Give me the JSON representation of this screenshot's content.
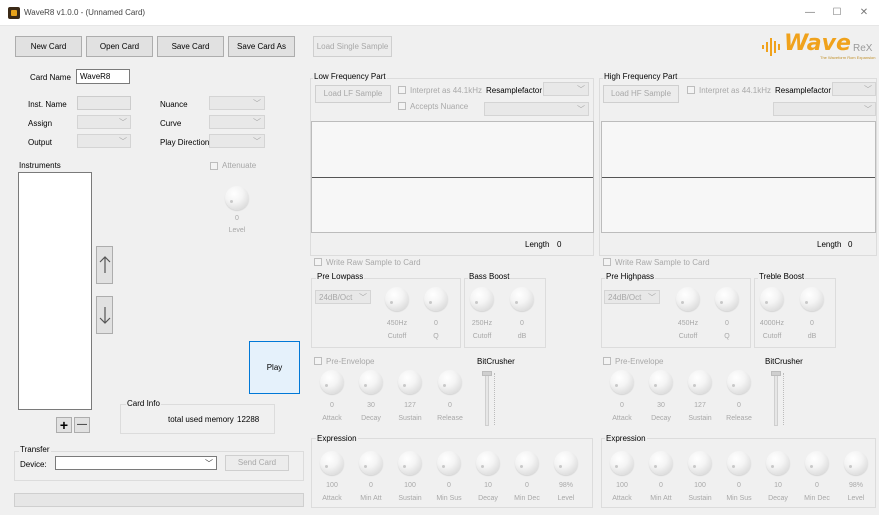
{
  "window": {
    "title": "WaveR8 v1.0.0 - (Unnamed Card)",
    "minimize": "—",
    "maximize": "☐",
    "close": "✕"
  },
  "toolbar": {
    "new_card": "New Card",
    "open_card": "Open Card",
    "save_card": "Save Card",
    "save_card_as": "Save Card As",
    "load_single_sample": "Load Single Sample"
  },
  "logo": {
    "text": "Wave",
    "suffix": "ReX",
    "tagline": "The Waveform Rom Expansion",
    "accent_color": "#f0a21c"
  },
  "card": {
    "name_label": "Card Name",
    "name_value": "WaveR8",
    "inst_name_label": "Inst. Name",
    "assign_label": "Assign",
    "output_label": "Output",
    "nuance_label": "Nuance",
    "curve_label": "Curve",
    "play_direction_label": "Play Direction"
  },
  "instruments": {
    "label": "Instruments",
    "attenuate_label": "Attenuate",
    "level_value": "0",
    "level_label": "Level",
    "up_icon": "arrow-up-icon",
    "down_icon": "arrow-down-icon",
    "add": "+",
    "remove": "—",
    "play": "Play"
  },
  "card_info": {
    "title": "Card Info",
    "memory_label": "total used memory",
    "memory_value": "12288"
  },
  "transfer": {
    "title": "Transfer",
    "device_label": "Device:",
    "send_card": "Send Card"
  },
  "low": {
    "title": "Low Frequency Part",
    "load_button": "Load LF Sample",
    "interpret_label": "Interpret as 44.1kHz",
    "accepts_nuance_label": "Accepts Nuance",
    "resample_label": "Resamplefactor",
    "length_label": "Length",
    "length_value": "0",
    "write_raw_label": "Write Raw Sample to Card",
    "filter_title": "Pre Lowpass",
    "filter_slope": "24dB/Oct",
    "filter_knobs": [
      {
        "value": "450Hz",
        "label": "Cutoff"
      },
      {
        "value": "0",
        "label": "Q"
      }
    ],
    "boost_title": "Bass Boost",
    "boost_knobs": [
      {
        "value": "250Hz",
        "label": "Cutoff"
      },
      {
        "value": "0",
        "label": "dB"
      }
    ],
    "envelope_label": "Pre-Envelope",
    "envelope_knobs": [
      {
        "value": "0",
        "label": "Attack"
      },
      {
        "value": "30",
        "label": "Decay"
      },
      {
        "value": "127",
        "label": "Sustain"
      },
      {
        "value": "0",
        "label": "Release"
      }
    ],
    "bitcrusher_label": "BitCrusher"
  },
  "high": {
    "title": "High Frequency Part",
    "load_button": "Load HF Sample",
    "interpret_label": "Interpret as 44.1kHz",
    "resample_label": "Resamplefactor",
    "length_label": "Length",
    "length_value": "0",
    "write_raw_label": "Write Raw Sample to Card",
    "filter_title": "Pre Highpass",
    "filter_slope": "24dB/Oct",
    "filter_knobs": [
      {
        "value": "450Hz",
        "label": "Cutoff"
      },
      {
        "value": "0",
        "label": "Q"
      }
    ],
    "boost_title": "Treble Boost",
    "boost_knobs": [
      {
        "value": "4000Hz",
        "label": "Cutoff"
      },
      {
        "value": "0",
        "label": "dB"
      }
    ],
    "envelope_label": "Pre-Envelope",
    "envelope_knobs": [
      {
        "value": "0",
        "label": "Attack"
      },
      {
        "value": "30",
        "label": "Decay"
      },
      {
        "value": "127",
        "label": "Sustain"
      },
      {
        "value": "0",
        "label": "Release"
      }
    ],
    "bitcrusher_label": "BitCrusher"
  },
  "expression_low": {
    "title": "Expression",
    "knobs": [
      {
        "value": "100",
        "label": "Attack"
      },
      {
        "value": "0",
        "label": "Min Att"
      },
      {
        "value": "100",
        "label": "Sustain"
      },
      {
        "value": "0",
        "label": "Min Sus"
      },
      {
        "value": "10",
        "label": "Decay"
      },
      {
        "value": "0",
        "label": "Min Dec"
      },
      {
        "value": "98%",
        "label": "Level"
      }
    ]
  },
  "expression_high": {
    "title": "Expression",
    "knobs": [
      {
        "value": "100",
        "label": "Attack"
      },
      {
        "value": "0",
        "label": "Min Att"
      },
      {
        "value": "100",
        "label": "Sustain"
      },
      {
        "value": "0",
        "label": "Min Sus"
      },
      {
        "value": "10",
        "label": "Decay"
      },
      {
        "value": "0",
        "label": "Min Dec"
      },
      {
        "value": "98%",
        "label": "Level"
      }
    ]
  }
}
